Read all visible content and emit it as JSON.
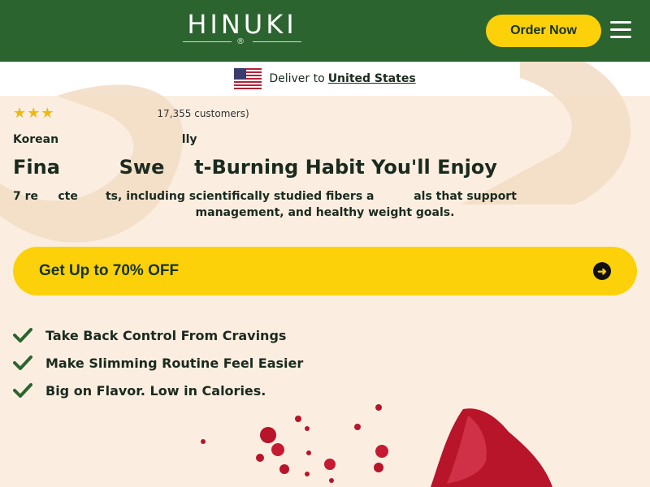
{
  "header": {
    "logo_text": "HINUKI",
    "order_label": "Order Now",
    "menu_icon": "hamburger-menu-icon",
    "background": "#2c6430",
    "accent": "#fdd10a"
  },
  "deliver": {
    "prefix": "Deliver to",
    "country": "United States",
    "flag_icon": "us-flag-icon"
  },
  "rating": {
    "stars": "★★★",
    "text": "17,355 customers)"
  },
  "hero": {
    "eyebrow": "Korean",
    "eyebrow_tail": "lly",
    "headline_a": "Fina",
    "headline_b": "Swe",
    "headline_c": "t-Burning Habit You'll Enjoy",
    "subhead_line1": "7 re     cte       ts, including scientifically studied fibers a          als that support",
    "subhead_line2": "management, and healthy weight goals."
  },
  "cta": {
    "label": "Get Up to 70% OFF",
    "arrow_icon": "arrow-right-circle-icon"
  },
  "benefits": [
    {
      "label": "Take Back Control From Cravings"
    },
    {
      "label": "Make Slimming Routine Feel Easier"
    },
    {
      "label": "Big on Flavor. Low in Calories."
    }
  ],
  "colors": {
    "page_bg": "#fbeee0",
    "check": "#2c6430",
    "juice": "#b8142a"
  }
}
